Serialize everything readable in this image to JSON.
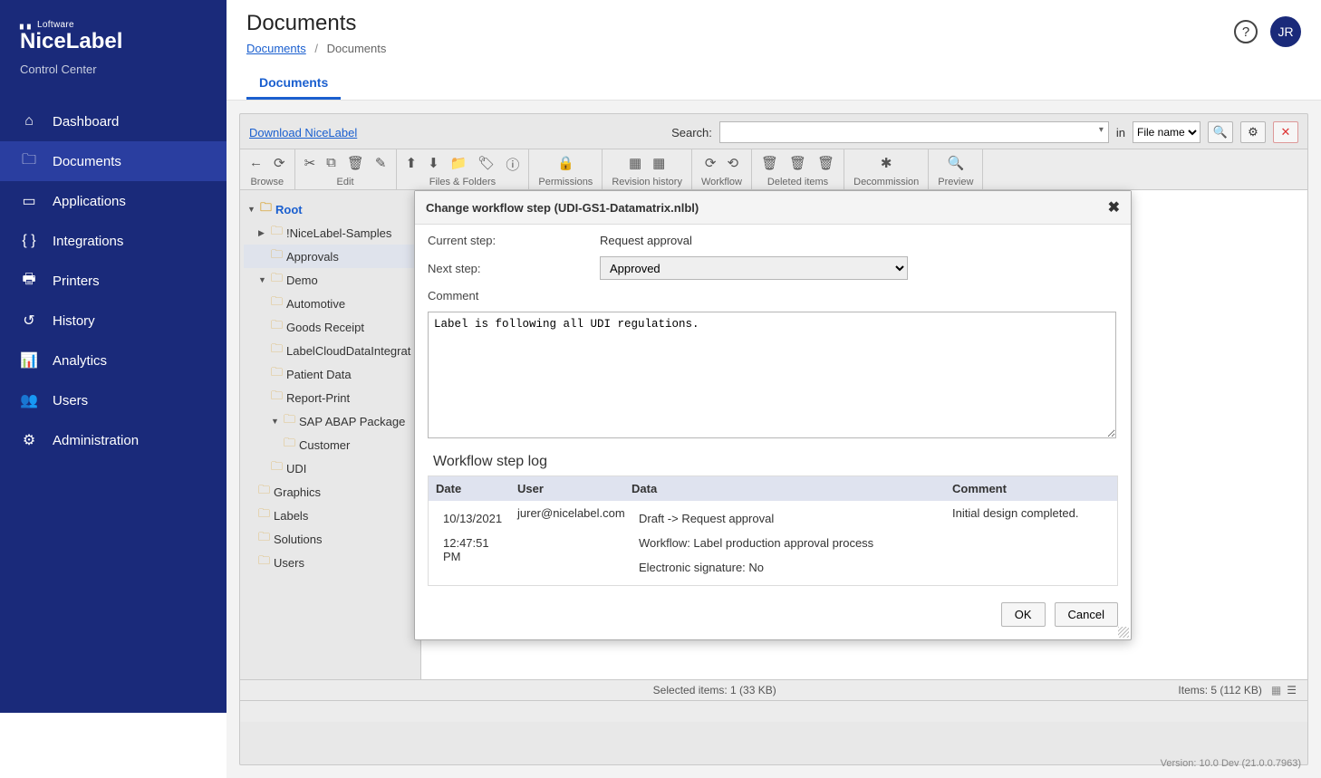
{
  "brand": {
    "top": "▖▖ Loftware",
    "main": "NiceLabel",
    "sub": "Control Center"
  },
  "nav": [
    {
      "icon": "⌂",
      "label": "Dashboard"
    },
    {
      "icon": "🗀",
      "label": "Documents"
    },
    {
      "icon": "▭",
      "label": "Applications"
    },
    {
      "icon": "{ }",
      "label": "Integrations"
    },
    {
      "icon": "🖶",
      "label": "Printers"
    },
    {
      "icon": "↺",
      "label": "History"
    },
    {
      "icon": "📊",
      "label": "Analytics"
    },
    {
      "icon": "👥",
      "label": "Users"
    },
    {
      "icon": "⚙",
      "label": "Administration"
    }
  ],
  "navActive": 1,
  "page": {
    "title": "Documents"
  },
  "breadcrumb": {
    "root": "Documents",
    "current": "Documents"
  },
  "avatar": "JR",
  "tabs": {
    "0": "Documents"
  },
  "search": {
    "download": "Download NiceLabel",
    "label": "Search:",
    "value": "",
    "in": "in",
    "field": "File name"
  },
  "toolbar": {
    "browse": "Browse",
    "edit": "Edit",
    "files": "Files & Folders",
    "permissions": "Permissions",
    "revision": "Revision history",
    "workflow": "Workflow",
    "deleted": "Deleted items",
    "decommission": "Decommission",
    "preview": "Preview"
  },
  "tree": {
    "root": "Root",
    "n0": "!NiceLabel-Samples",
    "n1": "Approvals",
    "n2": "Demo",
    "n2c": [
      "Automotive",
      "Goods Receipt",
      "LabelCloudDataIntegrat",
      "Patient Data",
      "Report-Print",
      "SAP ABAP Package",
      "Customer",
      "UDI"
    ],
    "n3": "Graphics",
    "n4": "Labels",
    "n5": "Solutions",
    "n6": "Users"
  },
  "dialog": {
    "title": "Change workflow step (UDI-GS1-Datamatrix.nlbl)",
    "currentLabel": "Current step:",
    "currentVal": "Request approval",
    "nextLabel": "Next step:",
    "nextVal": "Approved",
    "commentLabel": "Comment",
    "commentVal": "Label is following all UDI regulations.",
    "logTitle": "Workflow step log",
    "head": {
      "date": "Date",
      "user": "User",
      "data": "Data",
      "comment": "Comment"
    },
    "row": {
      "date1": "10/13/2021",
      "date2": "12:47:51 PM",
      "user": "jurer@nicelabel.com",
      "d1": "Draft -> Request approval",
      "d2": "Workflow: Label production approval process",
      "d3": "Electronic signature: No",
      "comment": "Initial design completed."
    },
    "ok": "OK",
    "cancel": "Cancel"
  },
  "status": {
    "selected": "Selected items: 1 (33 KB)",
    "items": "Items: 5 (112 KB)"
  },
  "version": "Version: 10.0 Dev (21.0.0.7963)"
}
